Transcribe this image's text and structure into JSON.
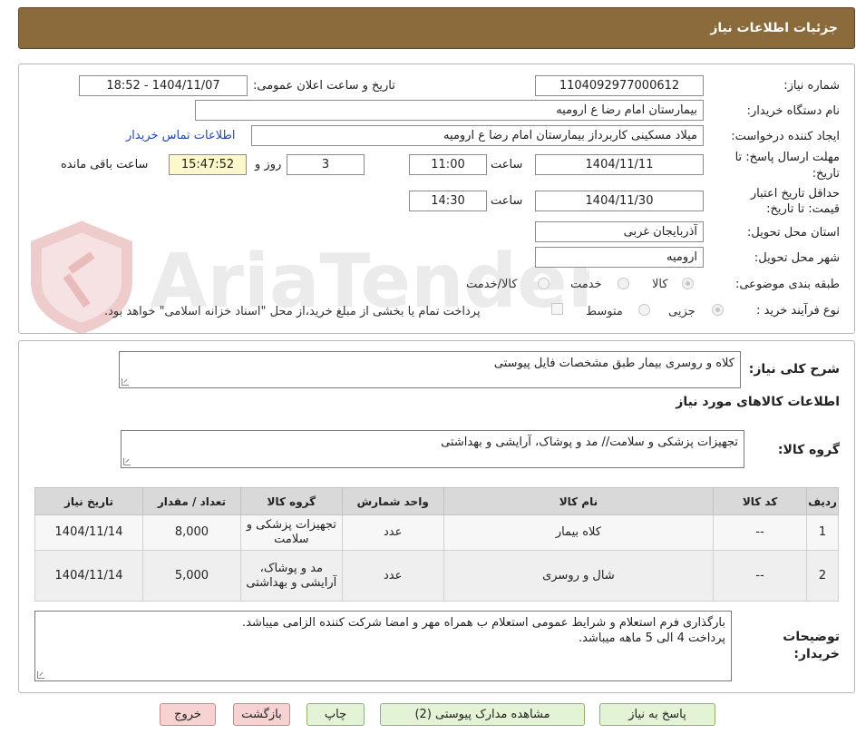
{
  "header": {
    "title": "جزئیات اطلاعات نیاز"
  },
  "fields": {
    "need_number_label": "شماره نیاز:",
    "need_number": "1104092977000612",
    "announce_label": "تاریخ و ساعت اعلان عمومی:",
    "announce_value": "1404/11/07 - 18:52",
    "buyer_org_label": "نام دستگاه خریدار:",
    "buyer_org": "بیمارستان امام رضا  ع  ارومیه",
    "requester_label": "ایجاد کننده درخواست:",
    "requester": "میلاد مسکینی کاربرداز بیمارستان امام رضا  ع  ارومیه",
    "contact_link": "اطلاعات تماس خریدار",
    "deadline_label_1": "مهلت ارسال پاسخ: تا",
    "deadline_label_2": "تاریخ:",
    "deadline_date": "1404/11/11",
    "time_label": "ساعت",
    "deadline_time": "11:00",
    "days_value": "3",
    "days_label": "روز و",
    "remaining_time": "15:47:52",
    "remaining_label": "ساعت باقی مانده",
    "validity_label_1": "حداقل تاریخ اعتبار",
    "validity_label_2": "قیمت: تا تاریخ:",
    "validity_date": "1404/11/30",
    "validity_time": "14:30",
    "province_label": "استان محل تحویل:",
    "province": "آذربایجان غربی",
    "city_label": "شهر محل تحویل:",
    "city": "ارومیه",
    "category_label": "طبقه بندی موضوعی:",
    "category_options": [
      "کالا",
      "خدمت",
      "کالا/خدمت"
    ],
    "process_label": "نوع فرآیند خرید :",
    "process_options": [
      "جزیی",
      "متوسط"
    ],
    "treasury_note": "پرداخت تمام یا بخشی از مبلغ خرید،از محل \"اسناد خزانه اسلامی\" خواهد بود."
  },
  "summary": {
    "label": "شرح کلی نیاز:",
    "text": "کلاه و روسری بیمار طبق مشخصات فایل پیوستی",
    "goods_info_title": "اطلاعات کالاهای مورد نیاز",
    "goods_group_label": "گروه کالا:",
    "goods_group": "تجهیزات پزشکی و سلامت// مد و پوشاک، آرایشی و بهداشتی"
  },
  "table": {
    "headers": [
      "ردیف",
      "کد کالا",
      "نام کالا",
      "واحد شمارش",
      "گروه کالا",
      "تعداد / مقدار",
      "تاریخ نیاز"
    ],
    "rows": [
      [
        "1",
        "--",
        "کلاه بیمار",
        "عدد",
        "تجهیزات پزشکی و سلامت",
        "8,000",
        "1404/11/14"
      ],
      [
        "2",
        "--",
        "شال و روسری",
        "عدد",
        "مد و پوشاک، آرایشی و بهداشتی",
        "5,000",
        "1404/11/14"
      ]
    ]
  },
  "buyer_notes": {
    "label_1": "توضیحات",
    "label_2": "خریدار:",
    "line_1": "بارگذاری فرم استعلام و شرایط عمومی استعلام ب همراه مهر و امضا شرکت کننده الزامی میباشد.",
    "line_2": "پرداخت 4 الی 5 ماهه میباشد."
  },
  "buttons": {
    "reply": "پاسخ به نیاز",
    "attachments": "مشاهده مدارک پیوستی (2)",
    "print": "چاپ",
    "back": "بازگشت",
    "exit": "خروج"
  },
  "watermark": {
    "text": "AriaTender.neT"
  },
  "colors": {
    "header_bg": "#8b6a3c",
    "link": "#2248b5",
    "remaining_bg": "#fdf7cc",
    "green_button": "#e4f3d6",
    "red_button": "#f6d2d2"
  }
}
